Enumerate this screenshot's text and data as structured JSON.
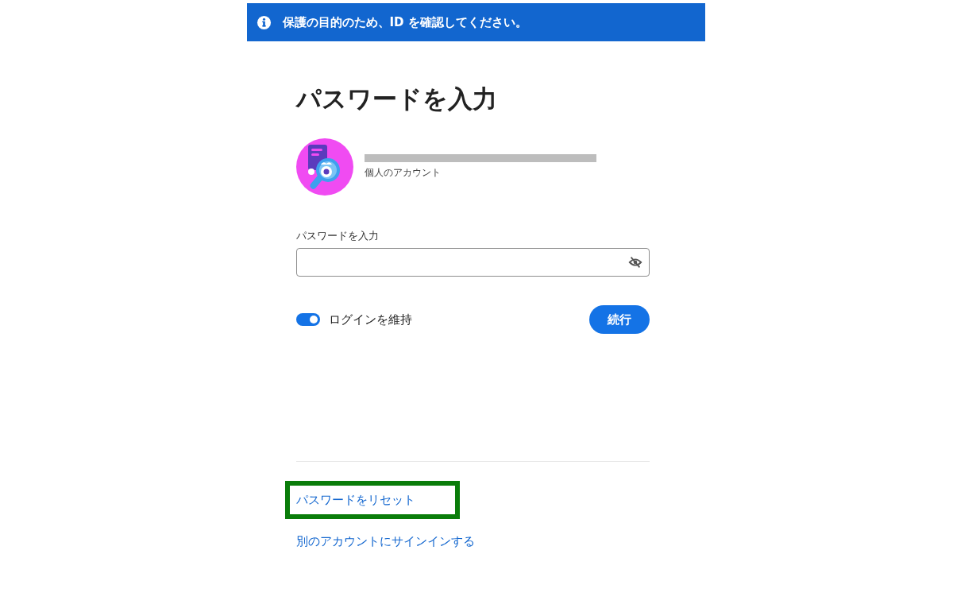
{
  "banner": {
    "text": "保護の目的のため、ID を確認してください。"
  },
  "title": "パスワードを入力",
  "account": {
    "email_redacted": true,
    "type": "個人のアカウント"
  },
  "password_field": {
    "label": "パスワードを入力"
  },
  "stay_signed_in": {
    "label": "ログインを維持",
    "on": true
  },
  "continue_button": "続行",
  "links": [
    {
      "text": "パスワードをリセット",
      "highlighted": true
    },
    {
      "text": "別のアカウントにサインインする",
      "highlighted": false
    }
  ]
}
